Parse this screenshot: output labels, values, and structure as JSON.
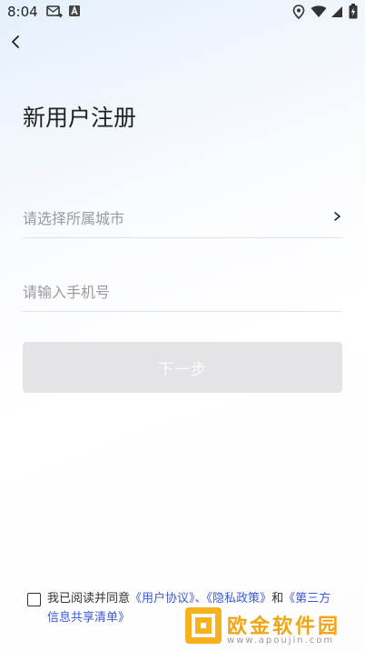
{
  "status_bar": {
    "time": "8:04",
    "left_icons": [
      "forward-mail-icon",
      "a-badge-icon"
    ],
    "right_icons": [
      "location-icon",
      "wifi-icon",
      "signal-icon",
      "battery-icon"
    ]
  },
  "header": {
    "back_icon": "chevron-left-icon"
  },
  "page": {
    "title": "新用户注册"
  },
  "form": {
    "city_placeholder": "请选择所属城市",
    "phone_placeholder": "请输入手机号",
    "next_button": "下一步"
  },
  "agreement": {
    "prefix": "我已阅读并同意",
    "user_agreement": "《用户协议》",
    "sep1": "、",
    "privacy_policy": "《隐私政策》",
    "and": "和",
    "third_party_list": "《第三方信息共享清单》"
  },
  "watermark": {
    "name": "欧金软件园",
    "url": "www.apoujin.com"
  },
  "colors": {
    "link": "#3b5bd6",
    "button_disabled": "#e4e4e6",
    "brand_orange": "#f0a517"
  }
}
